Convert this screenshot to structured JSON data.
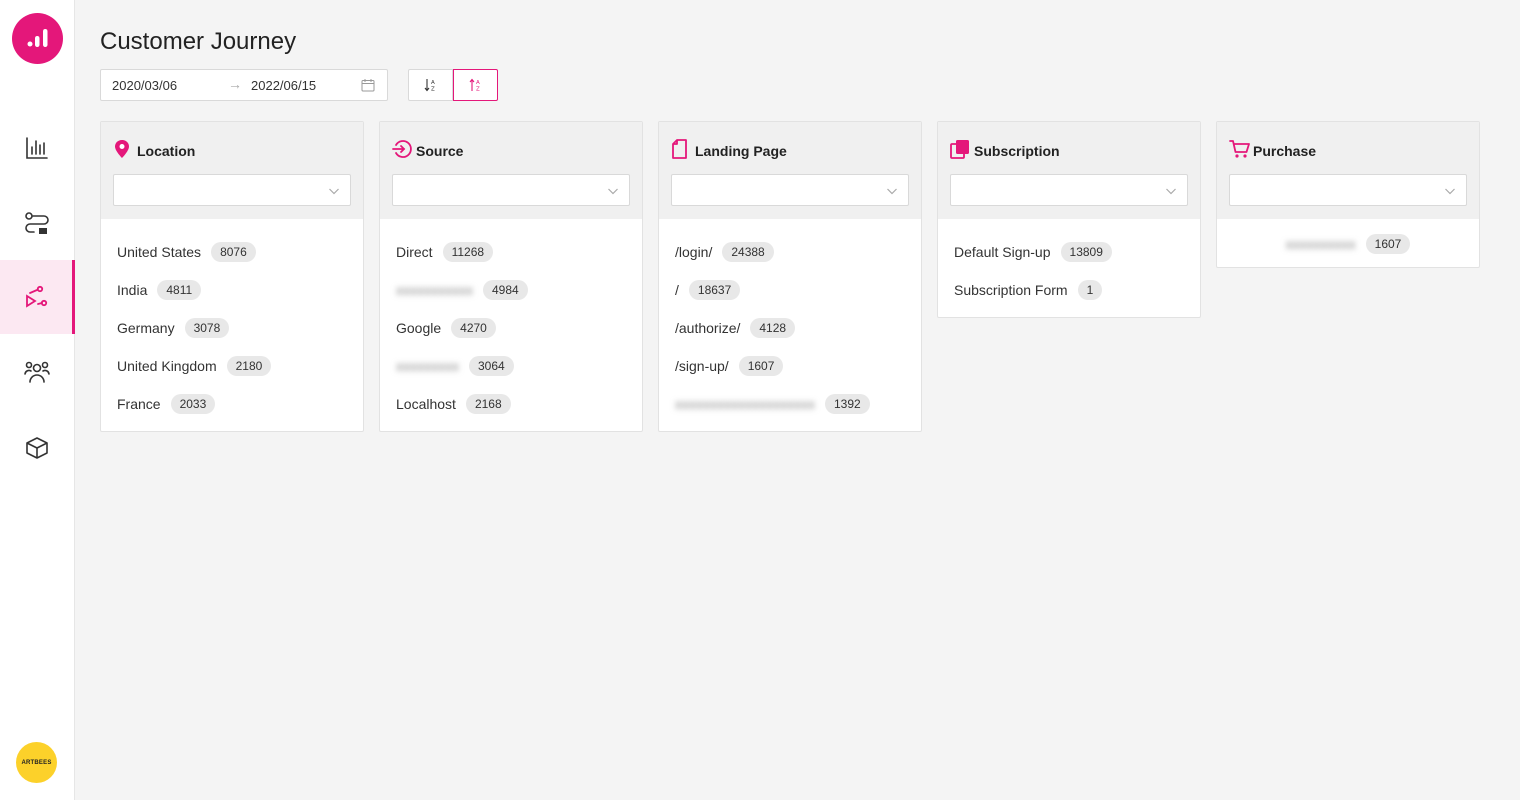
{
  "app": {
    "title": "Customer Journey",
    "accent_color": "#e4177a",
    "avatar_text": "ARTBEES"
  },
  "sidebar": {
    "items": [
      {
        "name": "analytics",
        "icon": "bar-chart-icon",
        "active": false
      },
      {
        "name": "flows",
        "icon": "route-icon",
        "active": false
      },
      {
        "name": "journey",
        "icon": "journey-icon",
        "active": true
      },
      {
        "name": "audience",
        "icon": "people-icon",
        "active": false
      },
      {
        "name": "products",
        "icon": "box-icon",
        "active": false
      }
    ]
  },
  "toolbar": {
    "date_start": "2020/03/06",
    "date_separator": "→",
    "date_end": "2022/06/15",
    "sort_desc_icon": "sort-descending-icon",
    "sort_asc_icon": "sort-ascending-icon"
  },
  "columns": [
    {
      "title": "Location",
      "icon": "location-pin-icon",
      "items": [
        {
          "label": "United States",
          "count": "8076"
        },
        {
          "label": "India",
          "count": "4811"
        },
        {
          "label": "Germany",
          "count": "3078"
        },
        {
          "label": "United Kingdom",
          "count": "2180"
        },
        {
          "label": "France",
          "count": "2033"
        }
      ]
    },
    {
      "title": "Source",
      "icon": "source-enter-icon",
      "items": [
        {
          "label": "Direct",
          "count": "11268"
        },
        {
          "label": "",
          "count": "4984",
          "redacted": true
        },
        {
          "label": "Google",
          "count": "4270"
        },
        {
          "label": "",
          "count": "3064",
          "redacted": true
        },
        {
          "label": "Localhost",
          "count": "2168"
        }
      ]
    },
    {
      "title": "Landing Page",
      "icon": "page-icon",
      "items": [
        {
          "label": "/login/",
          "count": "24388"
        },
        {
          "label": "/",
          "count": "18637"
        },
        {
          "label": "/authorize/",
          "count": "4128"
        },
        {
          "label": "/sign-up/",
          "count": "1607"
        },
        {
          "label": "",
          "count": "1392",
          "redacted": true
        }
      ]
    },
    {
      "title": "Subscription",
      "icon": "subscription-icon",
      "items": [
        {
          "label": "Default Sign-up",
          "count": "13809"
        },
        {
          "label": "Subscription Form",
          "count": "1"
        }
      ]
    },
    {
      "title": "Purchase",
      "icon": "cart-icon",
      "items": [
        {
          "label": "",
          "count": "1607",
          "redacted": true
        }
      ]
    }
  ]
}
